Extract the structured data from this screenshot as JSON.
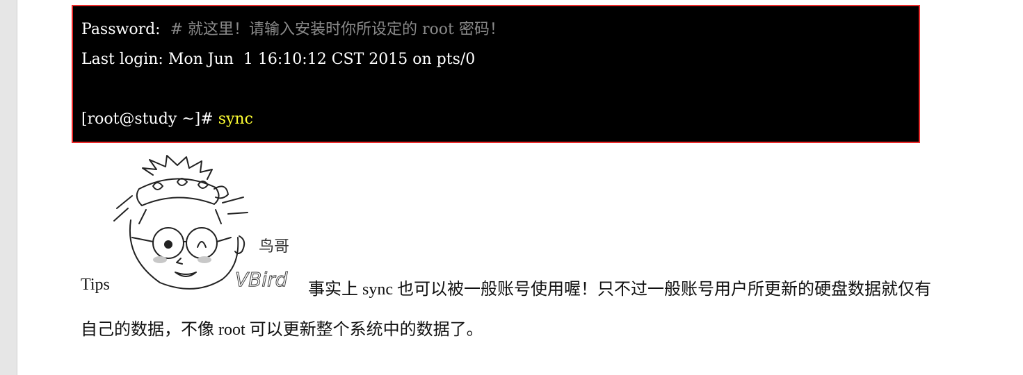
{
  "terminal": {
    "line1_prefix": "Password:  ",
    "line1_comment": "# 就这里！请输入安装时你所设定的 root 密码！",
    "line2": "Last login: Mon Jun  1 16:10:12 CST 2015 on pts/0",
    "line4_prompt": "[root@study ~]# ",
    "line4_command": "sync"
  },
  "tips": {
    "label": "Tips",
    "mascot_signature": "VBird",
    "mascot_caption": "鸟哥",
    "text_line1": "事实上 sync 也可以被一般账号使用喔！只不过一般账号用户所更新的硬盘数据就仅有",
    "text_line2": "自己的数据，不像 root 可以更新整个系统中的数据了。"
  },
  "colors": {
    "terminal_bg": "#000000",
    "terminal_border": "#ee2a2a",
    "terminal_text": "#ffffff",
    "comment_text": "#8a8a8a",
    "command_highlight": "#ffff33"
  }
}
